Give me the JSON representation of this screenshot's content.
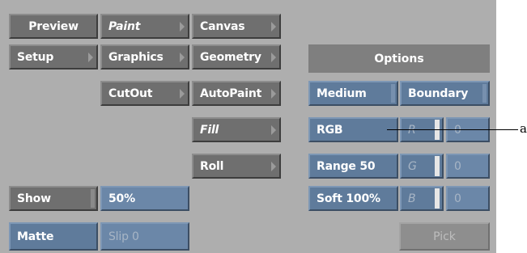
{
  "menu": {
    "preview": "Preview",
    "paint": "Paint",
    "canvas": "Canvas",
    "setup": "Setup",
    "graphics": "Graphics",
    "geometry": "Geometry",
    "cutout": "CutOut",
    "autopaint": "AutoPaint",
    "fill": "Fill",
    "roll": "Roll"
  },
  "bottom": {
    "show": "Show",
    "percent": "50%",
    "matte": "Matte",
    "slip": "Slip 0"
  },
  "options": {
    "header": "Options",
    "medium": "Medium",
    "boundary": "Boundary",
    "color_mode": "RGB",
    "range": "Range 50",
    "soft": "Soft 100%",
    "channels": [
      {
        "label": "R",
        "value": "0"
      },
      {
        "label": "G",
        "value": "0"
      },
      {
        "label": "B",
        "value": "0"
      }
    ],
    "pick": "Pick"
  },
  "callout": {
    "label": "a"
  },
  "colors": {
    "panel": "#aeaeae",
    "gray_button": "#6f6f6f",
    "blue_button": "#5f7b9b",
    "field_blue": "#6b87a8"
  },
  "icons": [
    "submenu-arrow-icon"
  ]
}
